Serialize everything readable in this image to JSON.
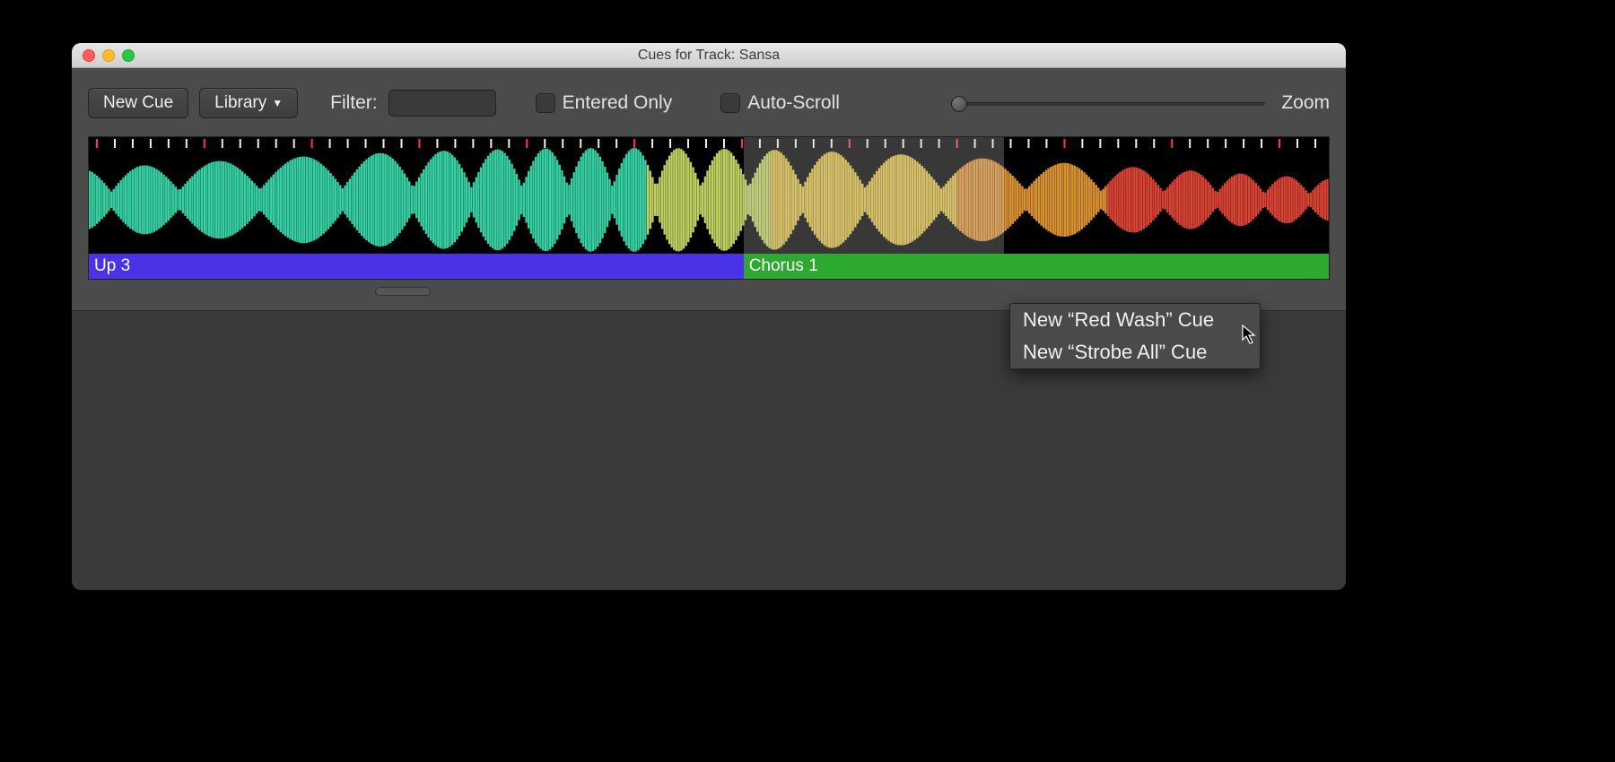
{
  "window": {
    "title": "Cues for Track: Sansa"
  },
  "toolbar": {
    "new_cue_label": "New Cue",
    "library_label": "Library",
    "filter_label": "Filter:",
    "entered_only_label": "Entered Only",
    "auto_scroll_label": "Auto-Scroll",
    "zoom_label": "Zoom"
  },
  "cues": {
    "up3_label": "Up 3",
    "chorus1_label": "Chorus 1"
  },
  "context_menu": {
    "item1": "New “Red Wash” Cue",
    "item2": "New “Strobe All” Cue"
  },
  "icons": {
    "caret_down": "chevron-down-icon"
  },
  "colors": {
    "cue_up3": "#4a32e6",
    "cue_chorus": "#2da92f"
  }
}
